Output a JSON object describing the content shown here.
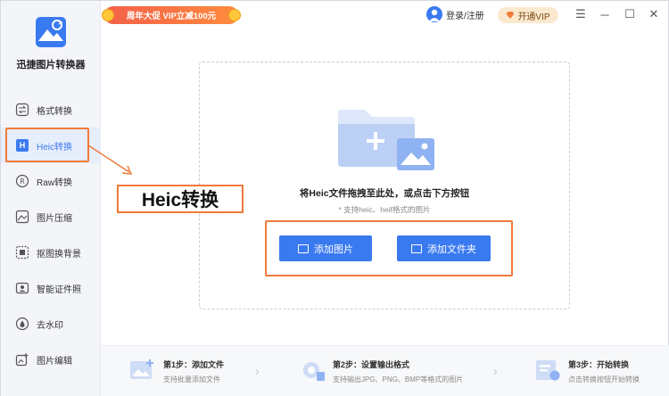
{
  "app": {
    "name": "迅捷图片转换器"
  },
  "promo": {
    "text": "周年大促 VIP立减100元"
  },
  "header": {
    "login_label": "登录/注册",
    "vip_label": "开通VIP"
  },
  "window_controls": {
    "menu": "☰",
    "minimize": "─",
    "maximize": "☐",
    "close": "✕"
  },
  "sidebar": {
    "items": [
      {
        "label": "格式转换",
        "icon": "convert-icon"
      },
      {
        "label": "Heic转换",
        "icon": "heic-icon",
        "badge": "H",
        "active": true
      },
      {
        "label": "Raw转换",
        "icon": "raw-icon"
      },
      {
        "label": "图片压缩",
        "icon": "compress-icon"
      },
      {
        "label": "抠图换背景",
        "icon": "cutout-icon"
      },
      {
        "label": "智能证件照",
        "icon": "id-photo-icon"
      },
      {
        "label": "去水印",
        "icon": "watermark-icon"
      },
      {
        "label": "图片编辑",
        "icon": "edit-icon"
      }
    ]
  },
  "annotation": {
    "label": "Heic转换"
  },
  "dropzone": {
    "title": "将Heic文件拖拽至此处，或点击下方按钮",
    "hint": "* 支持heic、heif格式的图片",
    "add_image_label": "添加图片",
    "add_folder_label": "添加文件夹"
  },
  "steps": [
    {
      "title": "第1步：添加文件",
      "desc": "支持批量添加文件"
    },
    {
      "title": "第2步：设置输出格式",
      "desc": "支持输出JPG、PNG、BMP等格式的图片"
    },
    {
      "title": "第3步：开始转换",
      "desc": "点击转换按钮开始转换"
    }
  ],
  "colors": {
    "accent": "#3a7af0",
    "highlight": "#f07a3a",
    "promo": "#f3604a"
  }
}
